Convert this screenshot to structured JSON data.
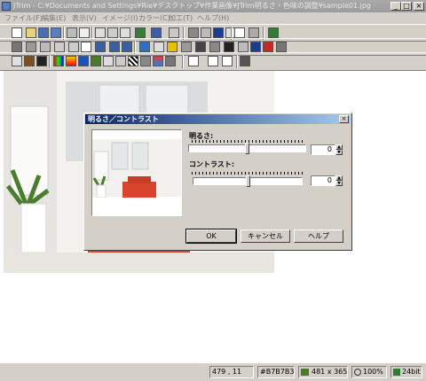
{
  "window": {
    "title": "JTrim - C:¥Documents and Settings¥Rie¥デスクトップ¥作業画像¥JTrim明るさ・色味の調整¥sample01.jpg"
  },
  "menu": [
    "ファイル(F)",
    "編集(E)",
    "表示(V)",
    "イメージ(I)",
    "カラー(C)",
    "加工(T)",
    "ヘルプ(H)"
  ],
  "dialog": {
    "title": "明るさ／コントラスト",
    "brightness_label": "明るさ:",
    "brightness_value": "0",
    "contrast_label": "コントラスト:",
    "contrast_value": "0",
    "ok": "OK",
    "cancel": "キャンセル",
    "help": "ヘルプ"
  },
  "status": {
    "coords": "479 , 11",
    "color": "#B7B7B3",
    "size": "481 x 365",
    "zoom": "100%",
    "depth": "24bit"
  },
  "colors": {
    "dialog_title_start": "#0a246a",
    "dialog_title_end": "#a6caf0",
    "sofa": "#d8442c"
  }
}
